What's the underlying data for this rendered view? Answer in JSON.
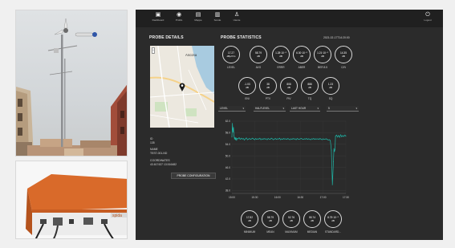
{
  "navigation": [
    {
      "label": "Dashboard",
      "icon": "dashboard-icon",
      "glyph": "▣"
    },
    {
      "label": "Profilo",
      "icon": "profile-icon",
      "glyph": "◉"
    },
    {
      "label": "Mappe",
      "icon": "map-icon",
      "glyph": "▤"
    },
    {
      "label": "Sonde",
      "icon": "probe-icon",
      "glyph": "▥"
    },
    {
      "label": "Utente",
      "icon": "user-icon",
      "glyph": "♙"
    }
  ],
  "logout": {
    "label": "Logout",
    "icon": "power-icon",
    "glyph": "⏻"
  },
  "probe_details": {
    "title": "PROBE DETAILS",
    "map_place": "Ancona",
    "id_label": "ID",
    "id_value": "135",
    "name_label": "NAME",
    "name_value": "TEST-001-ND",
    "coords_label": "COORDINATES",
    "coords_value": "43.617437 13.516482",
    "button_label": "PROBE CONFIGURATION"
  },
  "probe_statistics": {
    "title": "PROBE STATISTICS",
    "timestamp": "2021-02-17T14:20:00",
    "row1": [
      {
        "value": "17.27",
        "unit": "dBµV/m",
        "label": "LEVEL"
      },
      {
        "value": "58.79",
        "unit": "dB",
        "label": "AVG"
      },
      {
        "value": "1.28·10⁻⁵",
        "unit": "dB",
        "label": "ERRR"
      },
      {
        "value": "6.30·10⁻⁵",
        "unit": "dB",
        "label": "ABER"
      },
      {
        "value": "1.21·10⁻⁵",
        "unit": "dB",
        "label": "BER 8.5"
      },
      {
        "value": "14.35",
        "unit": "dB",
        "label": "C/N"
      }
    ],
    "row2": [
      {
        "value": "-1.03",
        "unit": "dB",
        "label": "ENI"
      },
      {
        "value": "38",
        "unit": "dB",
        "label": "PTV"
      },
      {
        "value": "808",
        "unit": "dB",
        "label": "PIV"
      },
      {
        "value": "888",
        "unit": "dB",
        "label": "TQ"
      },
      {
        "value": "1.23",
        "unit": "dB",
        "label": "SQ"
      }
    ],
    "selectors": [
      {
        "value": "LEVEL"
      },
      {
        "value": "HALFLEVEL"
      },
      {
        "value": "LAST HOUR"
      },
      {
        "value": "5"
      }
    ],
    "summary": [
      {
        "value": "17.82",
        "unit": "dB",
        "label": "MINIMUM"
      },
      {
        "value": "58.79",
        "unit": "dB",
        "label": "MEAN"
      },
      {
        "value": "52.76",
        "unit": "dB",
        "label": "MAXIMUM"
      },
      {
        "value": "55.74",
        "unit": "dB",
        "label": "MEDIAN"
      },
      {
        "value": "8.75·10⁻⁵",
        "unit": "dB",
        "label": "STANDARD..."
      }
    ]
  },
  "chart_data": {
    "type": "line",
    "xlabel": "",
    "ylabel": "",
    "x_ticks": [
      "15:00",
      "15:30",
      "16:00",
      "16:30",
      "17:00",
      "17:30"
    ],
    "y_ticks": [
      62.0,
      58.0,
      54.0,
      50.0,
      46.0,
      42.0,
      38.0
    ],
    "ylim": [
      37.0,
      62.0
    ],
    "series": [
      {
        "color": "#1fb5a6",
        "x": [
          0,
          0.5,
          1,
          1.5,
          2,
          2.5,
          3,
          3.5,
          4,
          4.5,
          5,
          6,
          7,
          8,
          9,
          10,
          11,
          12,
          13,
          14,
          15,
          16,
          17,
          18,
          19,
          20,
          21,
          22,
          23,
          24,
          25,
          26,
          27,
          28,
          29,
          30,
          31,
          32,
          33,
          34,
          35,
          36,
          37,
          38,
          39,
          40,
          41,
          42,
          43,
          44,
          45,
          46,
          47,
          48,
          49,
          50,
          51,
          52,
          53,
          54,
          55,
          56,
          57,
          58,
          59,
          60,
          61,
          62,
          63,
          64,
          65,
          66,
          67,
          68,
          69,
          70,
          71,
          72,
          73,
          74,
          75,
          76,
          77,
          78,
          79,
          80,
          81,
          82,
          83,
          84,
          85,
          86,
          87,
          88,
          89,
          90,
          91,
          92,
          93,
          94,
          95,
          96,
          97,
          98,
          98.5,
          99,
          99.5,
          100,
          101,
          102,
          103,
          104,
          105,
          106,
          107,
          108,
          109,
          110
        ],
        "y": [
          56.5,
          61.2,
          58.2,
          59.8,
          57.0,
          55.8,
          56.4,
          55.6,
          56.2,
          55.4,
          56.0,
          55.9,
          56.3,
          55.7,
          56.1,
          55.8,
          56.0,
          55.5,
          55.9,
          56.2,
          55.6,
          55.8,
          56.0,
          55.7,
          55.9,
          56.1,
          55.8,
          55.6,
          56.0,
          55.7,
          55.9,
          55.8,
          56.1,
          55.6,
          55.9,
          55.7,
          56.0,
          55.8,
          55.9,
          55.6,
          56.0,
          55.8,
          55.7,
          56.1,
          55.9,
          55.6,
          55.8,
          56.0,
          55.7,
          55.9,
          55.8,
          56.1,
          55.6,
          55.9,
          55.7,
          56.0,
          55.8,
          55.9,
          55.7,
          56.0,
          55.8,
          55.6,
          55.9,
          55.7,
          56.0,
          55.8,
          55.9,
          55.6,
          56.0,
          55.8,
          55.7,
          55.9,
          56.0,
          55.8,
          55.7,
          55.9,
          55.8,
          56.0,
          55.7,
          55.9,
          55.8,
          55.6,
          55.9,
          55.8,
          56.0,
          55.7,
          55.9,
          55.8,
          55.9,
          55.7,
          56.0,
          55.8,
          55.6,
          55.9,
          55.7,
          55.8,
          55.9,
          55.7,
          55.5,
          55.6,
          55.3,
          52.0,
          40.0,
          48.0,
          52.5,
          51.5,
          52.2,
          56.8,
          57.2,
          56.5,
          57.1,
          56.4,
          57.3,
          56.6,
          57.0,
          56.7,
          57.2,
          56.8
        ]
      }
    ],
    "grid": true,
    "legend": "none"
  }
}
